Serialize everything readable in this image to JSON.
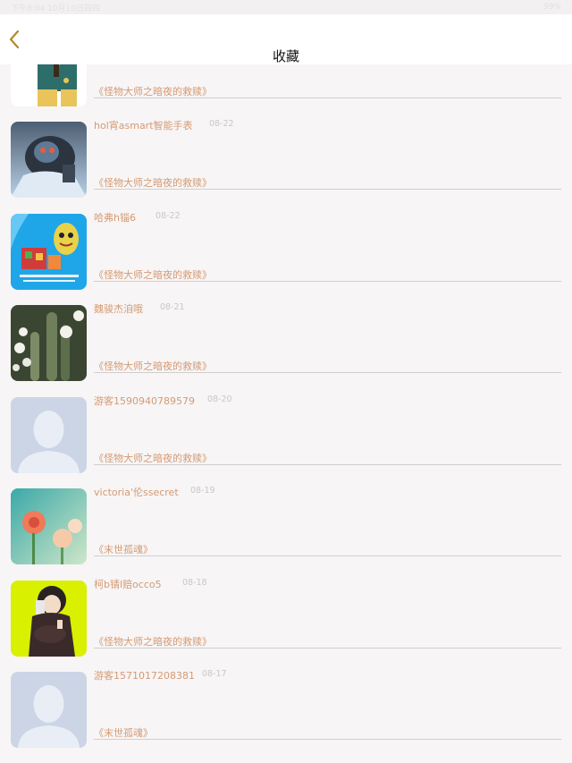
{
  "statusbar": {
    "left": "下午8:04  10月10日周四",
    "right": "99%"
  },
  "header": {
    "title": "收藏",
    "back_icon": "chevron-left-icon"
  },
  "colors": {
    "accent": "#d59a72",
    "divider": "#cfcfcf",
    "background": "#f7f5f6"
  },
  "items": [
    {
      "author": "",
      "date": "",
      "book": "《怪物大师之暗夜的救赎》",
      "thumb": "cartoon-avatar"
    },
    {
      "author": "hol宵asmart智能手表",
      "date": "08-22",
      "book": "《怪物大师之暗夜的救赎》",
      "thumb": "armored-warrior"
    },
    {
      "author": "哈弗h锱6",
      "date": "08-22",
      "book": "《怪物大师之暗夜的救赎》",
      "thumb": "cartoon-fruit"
    },
    {
      "author": "魏骏杰洎哦",
      "date": "08-21",
      "book": "《怪物大师之暗夜的救赎》",
      "thumb": "cactus-flowers"
    },
    {
      "author": "游客1590940789579",
      "date": "08-20",
      "book": "《怪物大师之暗夜的救赎》",
      "thumb": "default-avatar"
    },
    {
      "author": "victoria'伦ssecret",
      "date": "08-19",
      "book": "《末世孤魂》",
      "thumb": "flowers"
    },
    {
      "author": "柯b锖l赔occo5",
      "date": "08-18",
      "book": "《怪物大师之暗夜的救赎》",
      "thumb": "anime-boy"
    },
    {
      "author": "游客1571017208381",
      "date": "08-17",
      "book": "《末世孤魂》",
      "thumb": "default-avatar"
    }
  ]
}
